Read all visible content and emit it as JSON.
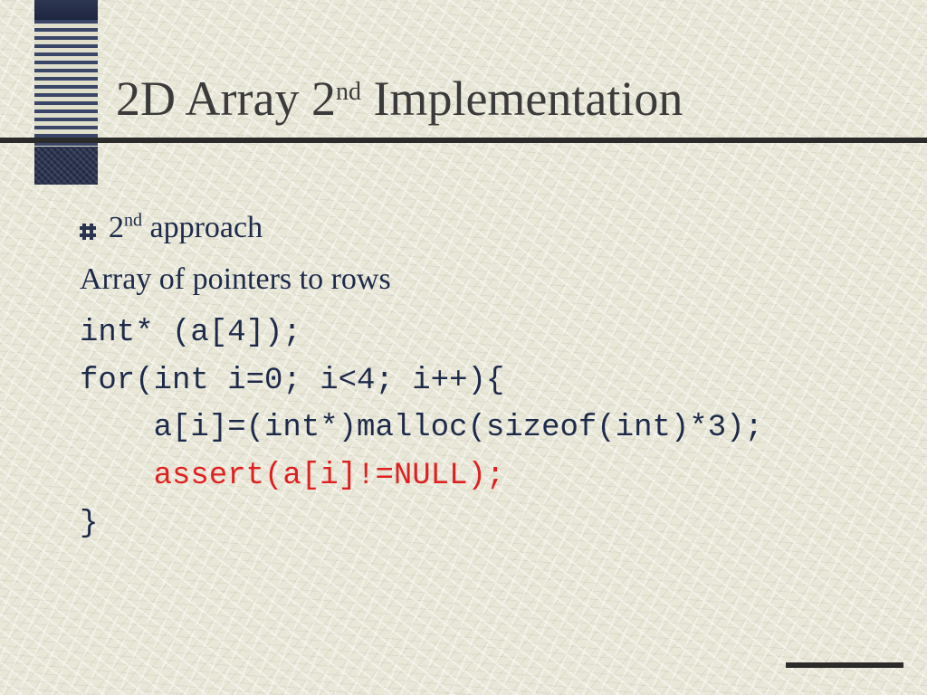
{
  "title": {
    "pre": "2D Array 2",
    "sup": "nd",
    "post": " Implementation"
  },
  "bullet": {
    "pre": "2",
    "sup": "nd",
    "post": " approach"
  },
  "subtitle": "Array of pointers to rows",
  "code": {
    "l1": "int* (a[4]);",
    "l2": "for(int i=0; i<4; i++){",
    "l3": "    a[i]=(int*)malloc(sizeof(int)*3);",
    "l4": "    assert(a[i]!=NULL);",
    "l5": "}"
  }
}
